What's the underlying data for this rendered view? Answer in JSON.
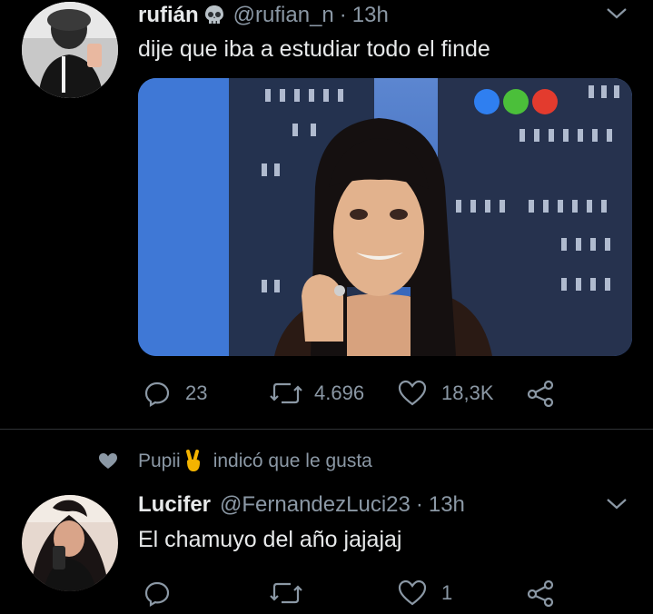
{
  "tweet1": {
    "name": "rufián",
    "name_emoji": "skull-icon",
    "handle": "@rufian_n",
    "time": "13h",
    "separator": "·",
    "text": "dije que iba a estudiar todo el finde",
    "reply_count": "23",
    "retweet_count": "4.696",
    "like_count": "18,3K"
  },
  "social_context": {
    "name": "Pupii",
    "name_emoji": "victory-hand-icon",
    "action": "indicó que le gusta"
  },
  "tweet2": {
    "name": "Lucifer",
    "handle": "@FernandezLuci23",
    "time": "13h",
    "separator": "·",
    "text": "El chamuyo del año jajajaj",
    "like_count": "1"
  },
  "colors": {
    "background": "#000000",
    "text_primary": "#e7e9ea",
    "text_secondary": "#8b98a5",
    "divider": "#2f3336"
  }
}
